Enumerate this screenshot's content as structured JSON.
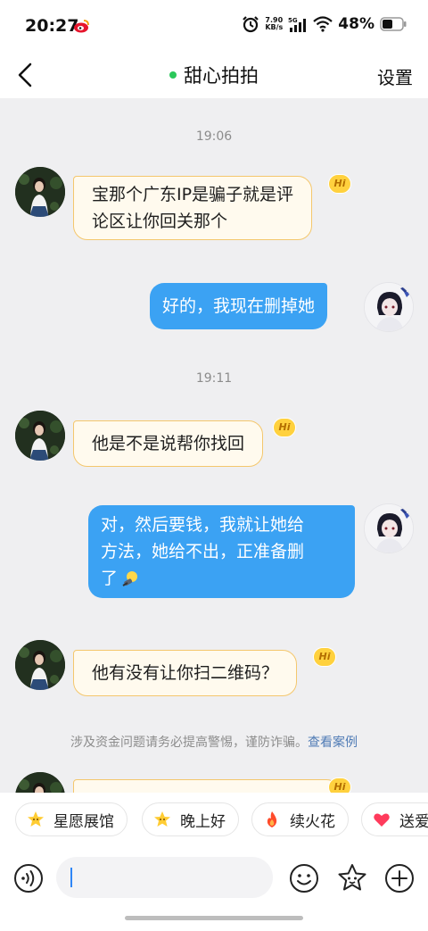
{
  "status_bar": {
    "time": "20:27",
    "net_speed_value": "7.90",
    "net_speed_unit": "KB/s",
    "signal_label": "5G",
    "battery": "48%"
  },
  "nav": {
    "title": "甜心拍拍",
    "settings": "设置"
  },
  "chat": {
    "time_1": "19:06",
    "msg_1_line_1": "宝那个广东IP是骗子就是评",
    "msg_1_line_2": "论区让你回关那个",
    "msg_2": "好的，我现在删掉她",
    "time_2": "19:11",
    "msg_3": "他是不是说帮你找回",
    "msg_4_line_1": "对，然后要钱，我就让她给",
    "msg_4_line_2": "方法，她给不出，正准备删",
    "msg_4_line_3": "了",
    "msg_5": "他有没有让你扫二维码？",
    "badge_text": "Hi",
    "notice": "涉及资金问题请务必提高警惕，谨防诈骗。",
    "notice_link": "查看案例"
  },
  "shortcuts": [
    {
      "label": "星愿展馆",
      "icon": "star-face-icon"
    },
    {
      "label": "晚上好",
      "icon": "star-face-icon"
    },
    {
      "label": "续火花",
      "icon": "fire-icon"
    },
    {
      "label": "送爱",
      "icon": "heart-icon"
    }
  ],
  "input": {
    "value": ""
  },
  "colors": {
    "outgoing_bubble": "#3ba2f3",
    "incoming_bubble": "#fffaee",
    "incoming_border": "#f4c76d",
    "online_dot": "#2bc85a",
    "chat_background": "#efeff1"
  }
}
